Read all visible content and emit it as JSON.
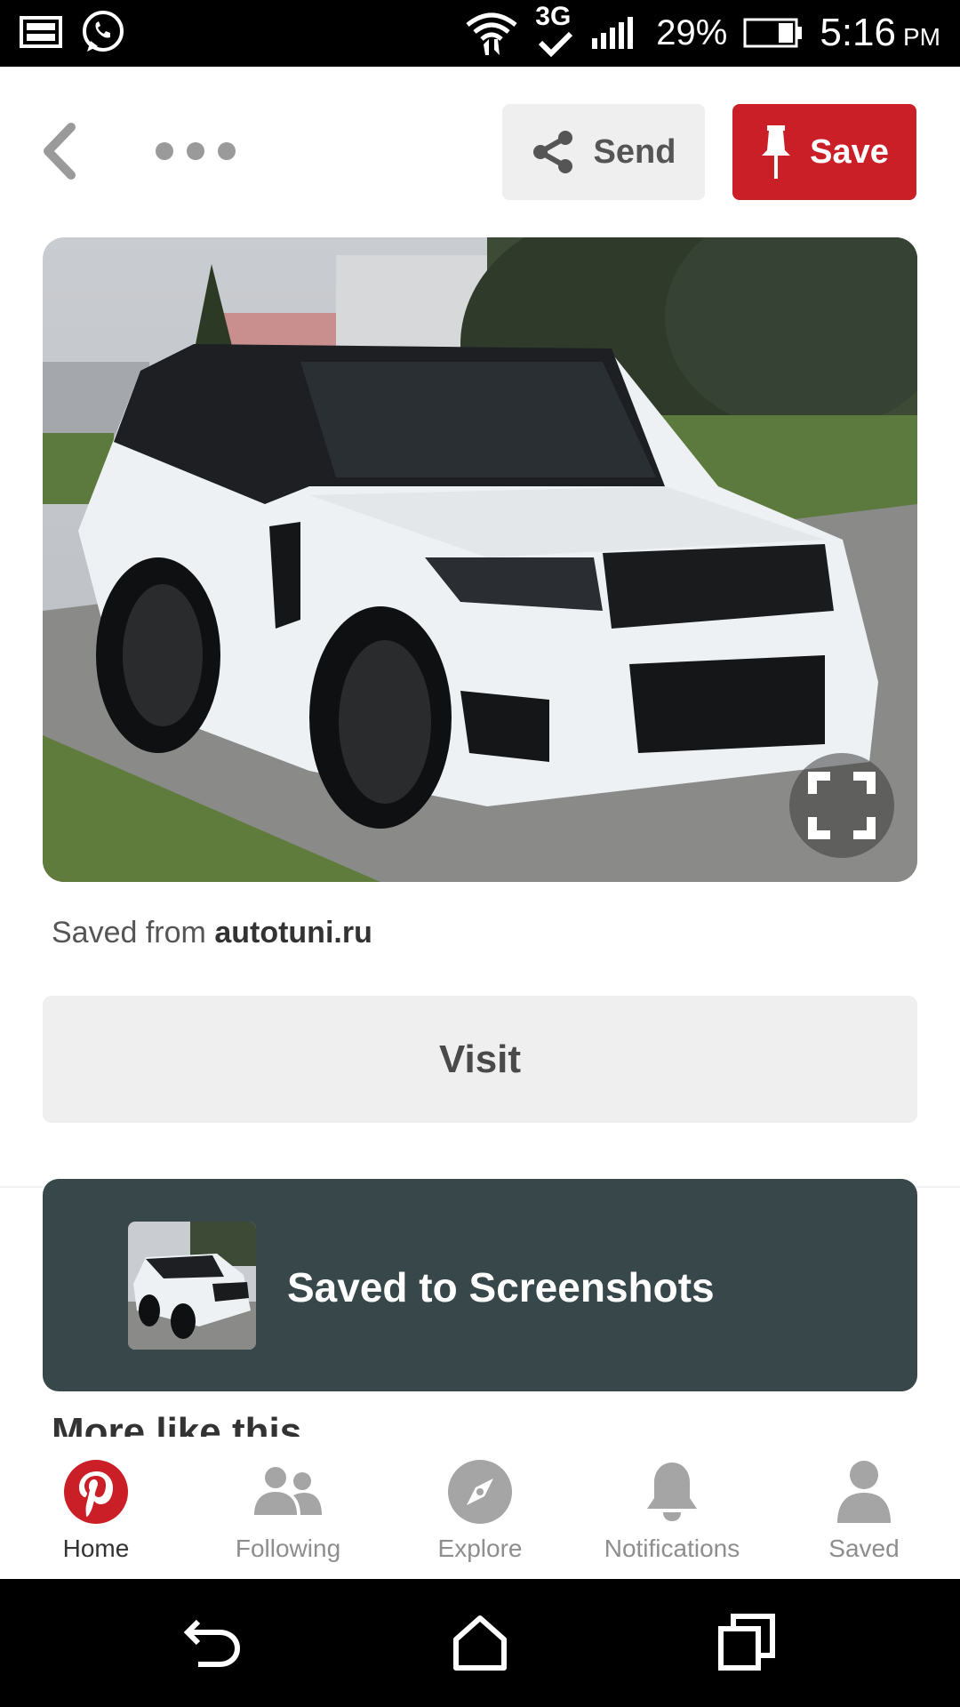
{
  "status_bar": {
    "battery": "29%",
    "time": "5:16",
    "ampm": "PM",
    "network": "3G"
  },
  "top_bar": {
    "send_label": "Send",
    "save_label": "Save"
  },
  "pin": {
    "image_description_icon": "car-photo",
    "saved_from_prefix": "Saved from",
    "saved_from_domain": "autotuni.ru",
    "visit_label": "Visit"
  },
  "toast": {
    "message": "Saved to Screenshots"
  },
  "section": {
    "more_like_this": "More like this"
  },
  "bottom_nav": {
    "items": [
      {
        "label": "Home",
        "icon": "pinterest-logo-icon",
        "active": true
      },
      {
        "label": "Following",
        "icon": "people-icon",
        "active": false
      },
      {
        "label": "Explore",
        "icon": "compass-icon",
        "active": false
      },
      {
        "label": "Notifications",
        "icon": "bell-icon",
        "active": false
      },
      {
        "label": "Saved",
        "icon": "person-icon",
        "active": false
      }
    ]
  },
  "colors": {
    "brand_red": "#cb1f27",
    "toast_bg": "#37474a",
    "button_gray": "#efefef",
    "icon_gray": "#9a9a9a"
  }
}
